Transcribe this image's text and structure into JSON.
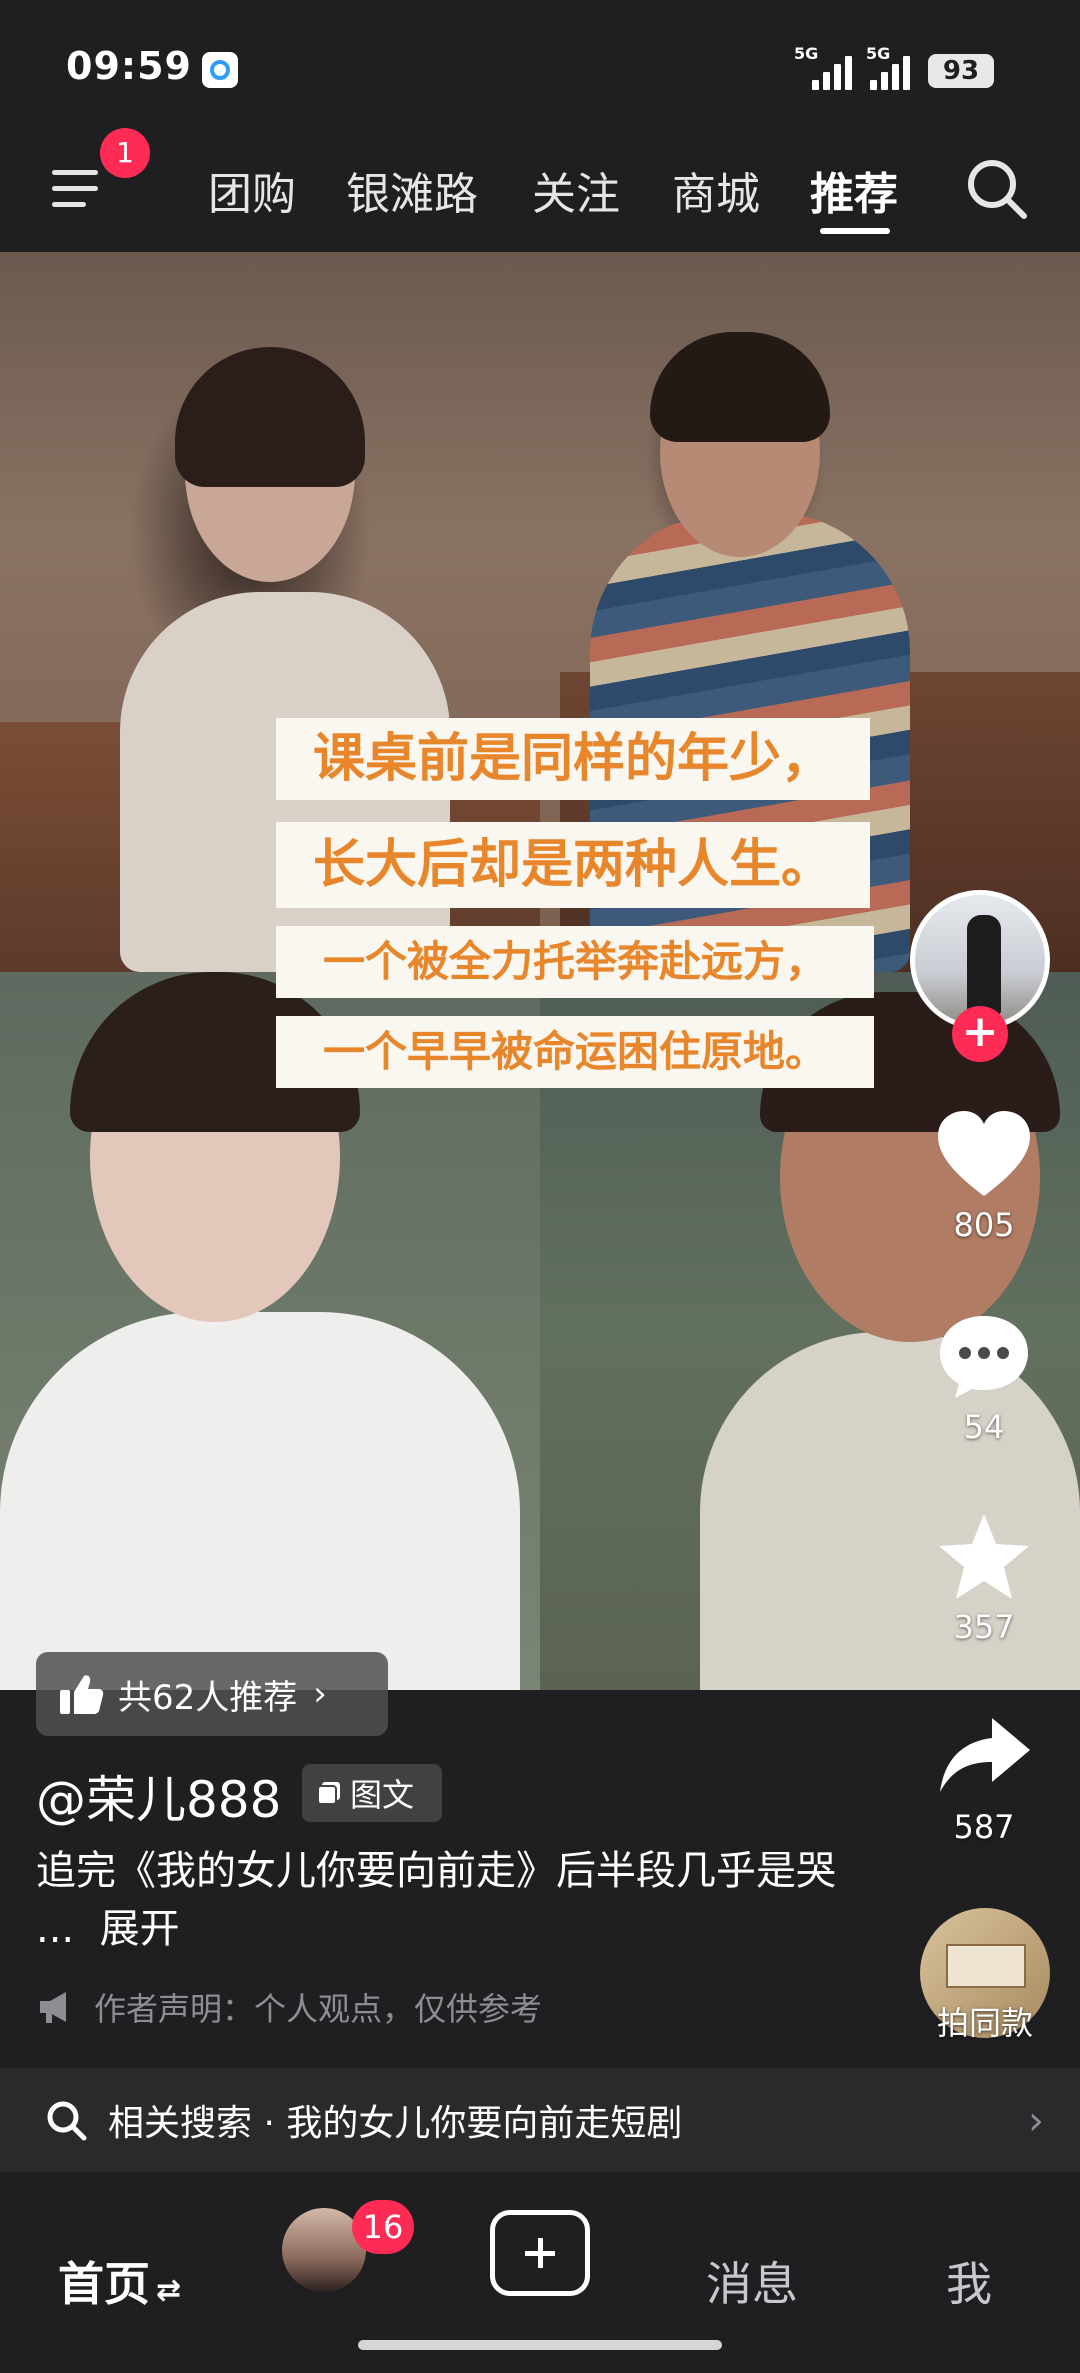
{
  "status_bar": {
    "time": "09:59",
    "signal1_label": "5G",
    "signal2_label": "5G",
    "battery": "93"
  },
  "top_nav": {
    "menu_badge": "1",
    "tabs": [
      "团购",
      "银滩路",
      "关注",
      "商城",
      "推荐"
    ],
    "active_tab": "推荐"
  },
  "post": {
    "captions": [
      "课桌前是同样的年少，",
      "长大后却是两种人生。",
      "一个被全力托举奔赴远方，",
      "一个早早被命运困住原地。"
    ],
    "recommend_text": "共62人推荐",
    "author": "@荣儿888",
    "tag": "图文",
    "description": "追完《我的女儿你要向前走》后半段几乎是哭 ...",
    "expand_label": "展开",
    "declaration": "作者声明：个人观点，仅供参考"
  },
  "actions": {
    "likes": "805",
    "comments": "54",
    "favorites": "357",
    "shares": "587",
    "same_style_label": "拍同款"
  },
  "related_search": {
    "text": "相关搜索 · 我的女儿你要向前走短剧"
  },
  "bottom_tabs": {
    "home": "首页",
    "home_suffix": "⇄",
    "friends_badge": "16",
    "messages": "消息",
    "me": "我"
  },
  "colors": {
    "background": "#1f1f21",
    "accent_red": "#fe2c55",
    "caption_orange": "#e8862c",
    "caption_bg": "#faf7f0"
  }
}
